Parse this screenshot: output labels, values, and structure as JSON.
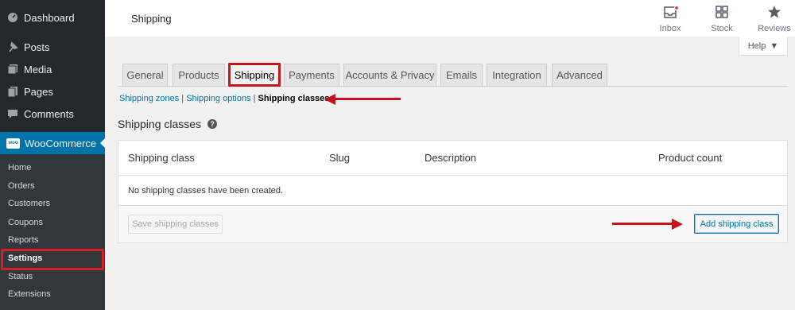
{
  "sidebar": {
    "items": [
      {
        "label": "Dashboard",
        "icon": "dashboard-icon"
      },
      {
        "label": "Posts",
        "icon": "pin-icon"
      },
      {
        "label": "Media",
        "icon": "media-icon"
      },
      {
        "label": "Pages",
        "icon": "pages-icon"
      },
      {
        "label": "Comments",
        "icon": "comments-icon"
      }
    ],
    "woocommerce": {
      "label": "WooCommerce",
      "badge": "woo",
      "icon": "woo-icon"
    },
    "submenu": [
      {
        "label": "Home"
      },
      {
        "label": "Orders"
      },
      {
        "label": "Customers"
      },
      {
        "label": "Coupons"
      },
      {
        "label": "Reports"
      },
      {
        "label": "Settings"
      },
      {
        "label": "Status"
      },
      {
        "label": "Extensions"
      }
    ]
  },
  "header": {
    "title": "Shipping",
    "actions": [
      {
        "label": "Inbox",
        "icon": "inbox-icon"
      },
      {
        "label": "Stock",
        "icon": "stock-icon"
      },
      {
        "label": "Reviews",
        "icon": "star-icon"
      }
    ],
    "help_label": "Help"
  },
  "tabs": [
    {
      "label": "General"
    },
    {
      "label": "Products"
    },
    {
      "label": "Shipping"
    },
    {
      "label": "Payments"
    },
    {
      "label": "Accounts & Privacy"
    },
    {
      "label": "Emails"
    },
    {
      "label": "Integration"
    },
    {
      "label": "Advanced"
    }
  ],
  "subnav": {
    "zones": "Shipping zones",
    "sep1": " | ",
    "options": "Shipping options",
    "sep2": " | ",
    "classes": "Shipping classes"
  },
  "section": {
    "title": "Shipping classes"
  },
  "table": {
    "headers": [
      "Shipping class",
      "Slug",
      "Description",
      "Product count"
    ],
    "empty_message": "No shipping classes have been created.",
    "save_label": "Save shipping classes",
    "add_label": "Add shipping class"
  },
  "colors": {
    "sidebar_bg": "#23282d",
    "active_blue": "#0073aa",
    "annotation_red": "#c9121a"
  }
}
